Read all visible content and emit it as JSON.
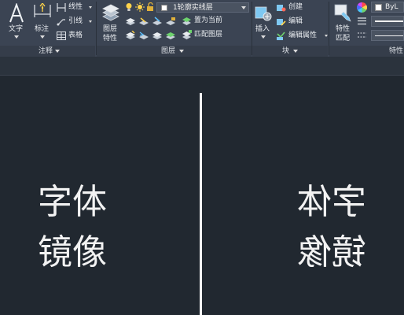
{
  "ribbon": {
    "annotation_panel": {
      "title": "注释",
      "text_label": "文字",
      "dimension_label": "标注",
      "linear_label": "线性",
      "leader_label": "引线",
      "table_label": "表格"
    },
    "layers_panel": {
      "title": "图层",
      "layer_props_label_line1": "图层",
      "layer_props_label_line2": "特性",
      "current_layer": "1轮廓实线层",
      "set_current_label": "置为当前",
      "match_layer_label": "匹配图层"
    },
    "block_panel": {
      "title": "块",
      "insert_label": "插入",
      "create_label": "创建",
      "edit_label": "编辑",
      "edit_attributes_label": "编辑属性"
    },
    "properties_panel": {
      "title": "特性",
      "match_props_line1": "特性",
      "match_props_line2": "匹配",
      "color_value": "ByL"
    }
  },
  "drawing": {
    "original_line1": "字体",
    "original_line2": "镜像",
    "mirrored_line1": "字体",
    "mirrored_line2": "镜像"
  },
  "colors": {
    "ribbon_bg": "#3b4453",
    "canvas_bg": "#212830",
    "text": "#f2f2f2"
  }
}
